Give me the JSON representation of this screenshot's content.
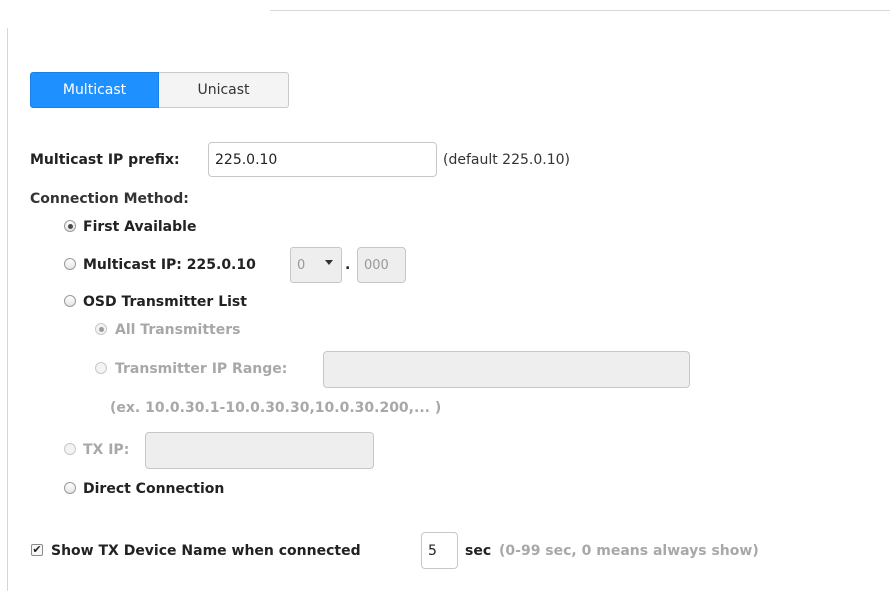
{
  "tabs": [
    {
      "label": "Multicast",
      "active": true
    },
    {
      "label": "Unicast",
      "active": false
    }
  ],
  "multicast_prefix": {
    "label": "Multicast IP prefix:",
    "value": "225.0.10",
    "hint": "(default 225.0.10)"
  },
  "connection_method": {
    "label": "Connection Method:",
    "first_available": "First Available",
    "multicast_ip": {
      "label": "Multicast IP: 225.0.10",
      "select_value": "0",
      "dot": ".",
      "last_octet": "000"
    },
    "osd_list": {
      "label": "OSD Transmitter List",
      "all_transmitters": "All Transmitters",
      "ip_range_label": "Transmitter IP Range:",
      "ip_range_value": "",
      "example": "(ex. 10.0.30.1-10.0.30.30,10.0.30.200,... )"
    },
    "tx_ip": {
      "label": "TX IP:",
      "value": ""
    },
    "direct": "Direct Connection",
    "selected": "first_available"
  },
  "show_name": {
    "checked": true,
    "label": "Show TX Device Name when connected",
    "value": "5",
    "unit": "sec",
    "hint": "(0-99 sec, 0 means always show)"
  }
}
